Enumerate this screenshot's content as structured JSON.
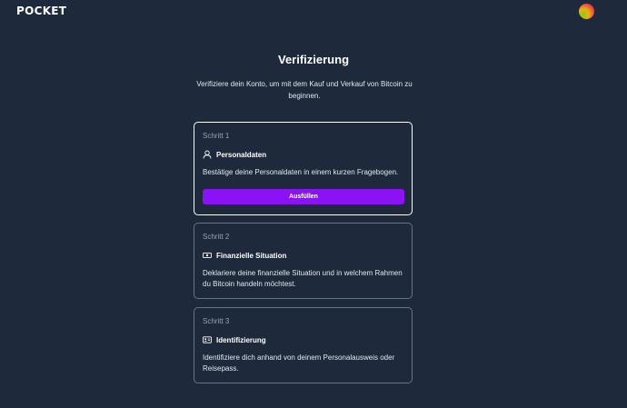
{
  "header": {
    "logo_text": "POCKET",
    "avatar_icon": "user-avatar-gradient"
  },
  "page": {
    "title": "Verifizierung",
    "subtitle": "Verifiziere dein Konto, um mit dem Kauf und Verkauf von Bitcoin zu beginnen."
  },
  "steps": [
    {
      "step_label": "Schritt 1",
      "icon": "user-icon",
      "title": "Personaldaten",
      "description": "Bestätige deine Personaldaten in einem kurzen Fragebogen.",
      "button_label": "Ausfüllen",
      "active": true
    },
    {
      "step_label": "Schritt 2",
      "icon": "money-icon",
      "title": "Finanzielle Situation",
      "description": "Deklariere deine finanzielle Situation und in welchem Rahmen du Bitcoin handeln möchtest.",
      "active": false
    },
    {
      "step_label": "Schritt 3",
      "icon": "id-card-icon",
      "title": "Identifizierung",
      "description": "Identifiziere dich anhand von deinem Personalausweis oder Reisepass.",
      "active": false
    }
  ],
  "colors": {
    "background": "#1e293b",
    "accent": "#8b12f5",
    "card_border": "#64748b",
    "active_border": "#ffffff"
  }
}
